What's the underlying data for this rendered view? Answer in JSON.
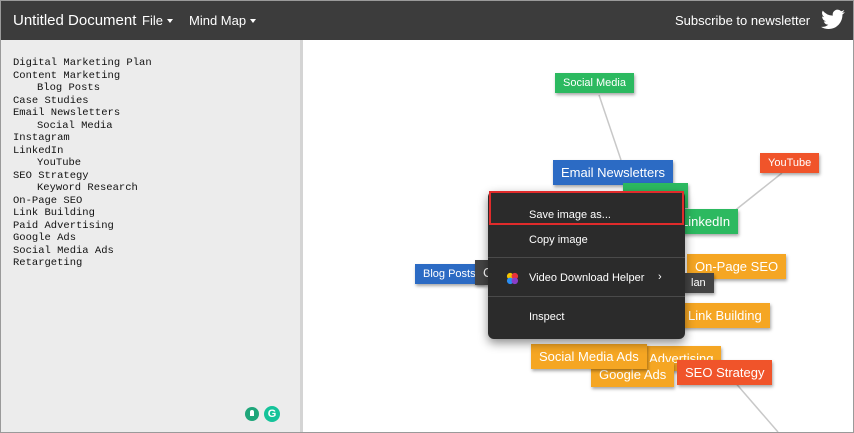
{
  "app": {
    "title": "Untitled Document",
    "menus": [
      "File",
      "Mind Map"
    ],
    "subscribe": "Subscribe to newsletter",
    "twitter_icon": "twitter-bird-icon"
  },
  "outline": [
    {
      "text": "Digital Marketing Plan",
      "indent": 0
    },
    {
      "text": "Content Marketing",
      "indent": 0
    },
    {
      "text": "Blog Posts",
      "indent": 1
    },
    {
      "text": "Case Studies",
      "indent": 0
    },
    {
      "text": "Email Newsletters",
      "indent": 0
    },
    {
      "text": "Social Media",
      "indent": 1
    },
    {
      "text": "Instagram",
      "indent": 0
    },
    {
      "text": "LinkedIn",
      "indent": 0
    },
    {
      "text": "YouTube",
      "indent": 1
    },
    {
      "text": "SEO Strategy",
      "indent": 0
    },
    {
      "text": "Keyword Research",
      "indent": 1
    },
    {
      "text": "On-Page SEO",
      "indent": 0
    },
    {
      "text": "Link Building",
      "indent": 0
    },
    {
      "text": "Paid Advertising",
      "indent": 0
    },
    {
      "text": "Google Ads",
      "indent": 0
    },
    {
      "text": "Social Media Ads",
      "indent": 0
    },
    {
      "text": "Retargeting",
      "indent": 0
    }
  ],
  "mindmap": {
    "nodes": {
      "social_media": "Social Media",
      "email_newsletters": "Email Newsletters",
      "youtube": "YouTube",
      "instagram_partial": "n",
      "linkedin": "LinkedIn",
      "blog_posts": "Blog Posts",
      "content_partial": "C",
      "on_page_seo": "On-Page SEO",
      "plan_partial": "lan",
      "link_building": "Link Building",
      "social_media_ads": "Social Media Ads",
      "paid_advertising_partial": "d Advertising",
      "google_ads": "Google Ads",
      "seo_strategy": "SEO Strategy"
    }
  },
  "context_menu": {
    "items": [
      "Save image as...",
      "Copy image",
      "Video Download Helper",
      "Inspect"
    ]
  },
  "colors": {
    "topbar": "#3c3c3c",
    "green": "#2cb960",
    "blue": "#2c6bc4",
    "orange": "#f5a623",
    "red": "#f0542a",
    "highlight": "#e02b2b"
  },
  "icons": [
    "lightbulb-icon",
    "grammarly-icon",
    "video-download-helper-icon",
    "chevron-right-icon"
  ]
}
